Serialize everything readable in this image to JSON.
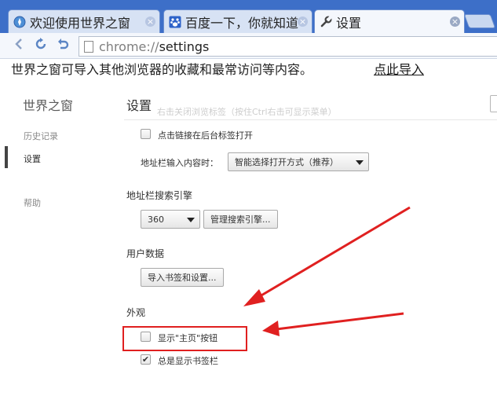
{
  "tabs": [
    {
      "title": "欢迎使用世界之窗",
      "icon": "globe-icon"
    },
    {
      "title": "百度一下，你就知道",
      "icon": "baidu-paw-icon"
    },
    {
      "title": "设置",
      "icon": "wrench-icon"
    }
  ],
  "toolbar": {
    "url_scheme": "chrome://",
    "url_path": "settings"
  },
  "infobar": {
    "message": "世界之窗可导入其他浏览器的收藏和最常访问等内容。",
    "link": "点此导入"
  },
  "sidebar": {
    "title": "世界之窗",
    "items": [
      {
        "label": "历史记录"
      },
      {
        "label": "设置"
      },
      {
        "label": "帮助"
      }
    ]
  },
  "main": {
    "title": "设置",
    "ghost_text": "右击关闭浏览标签（按住Ctrl右击可显示菜单）",
    "open_links_background": {
      "label": "点击链接在后台标签打开",
      "checked": false
    },
    "address_bar_input_label": "地址栏输入内容时：",
    "address_bar_input_value": "智能选择打开方式（推荐）",
    "search_engine": {
      "title": "地址栏搜索引擎",
      "selected": "360",
      "manage_button": "管理搜索引擎..."
    },
    "user_data": {
      "title": "用户数据",
      "import_button": "导入书签和设置..."
    },
    "appearance": {
      "title": "外观",
      "show_home_button": {
        "label": "显示\"主页\"按钮",
        "checked": false
      },
      "always_show_bookmarks": {
        "label": "总是显示书签栏",
        "checked": true
      }
    }
  },
  "colors": {
    "tabstrip": "#3d6fc8",
    "annotation_red": "#e02020"
  }
}
